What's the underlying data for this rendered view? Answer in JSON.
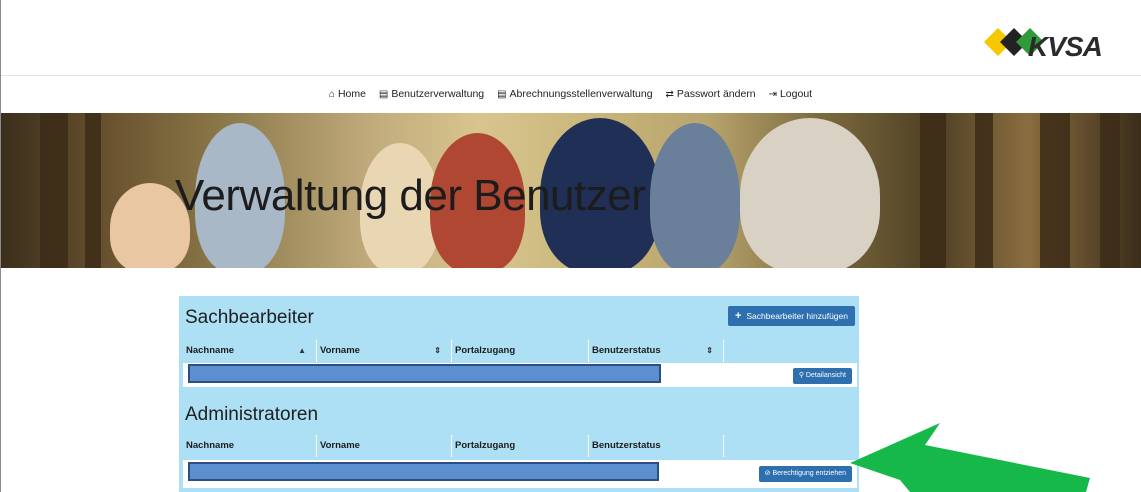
{
  "brand": {
    "logo_text": "KVSA",
    "colors": {
      "yellow": "#f5c800",
      "green": "#2e9a3a",
      "dark": "#2b2b2b"
    }
  },
  "nav": [
    {
      "icon": "home-icon",
      "glyph": "⌂",
      "label": "Home"
    },
    {
      "icon": "list-icon",
      "glyph": "▤",
      "label": "Benutzerverwaltung"
    },
    {
      "icon": "list-icon",
      "glyph": "▤",
      "label": "Abrechnungsstellenverwaltung"
    },
    {
      "icon": "retweet-icon",
      "glyph": "⇄",
      "label": "Passwort ändern"
    },
    {
      "icon": "logout-icon",
      "glyph": "⇥",
      "label": "Logout"
    }
  ],
  "hero": {
    "title": "Verwaltung der Benutzer"
  },
  "sachbearbeiter": {
    "title": "Sachbearbeiter",
    "add_button": "Sachbearbeiter hinzufügen",
    "columns": [
      "Nachname",
      "Vorname",
      "Portalzugang",
      "Benutzerstatus"
    ],
    "row_button": "Detailansicht"
  },
  "administratoren": {
    "title": "Administratoren",
    "columns": [
      "Nachname",
      "Vorname",
      "Portalzugang",
      "Benutzerstatus"
    ],
    "row_button": "Berechtigung entziehen"
  },
  "accent_colors": {
    "panel": "#aee0f5",
    "button": "#2e6fb0",
    "arrow": "#17b84a",
    "redaction": "#5b8fcf"
  }
}
